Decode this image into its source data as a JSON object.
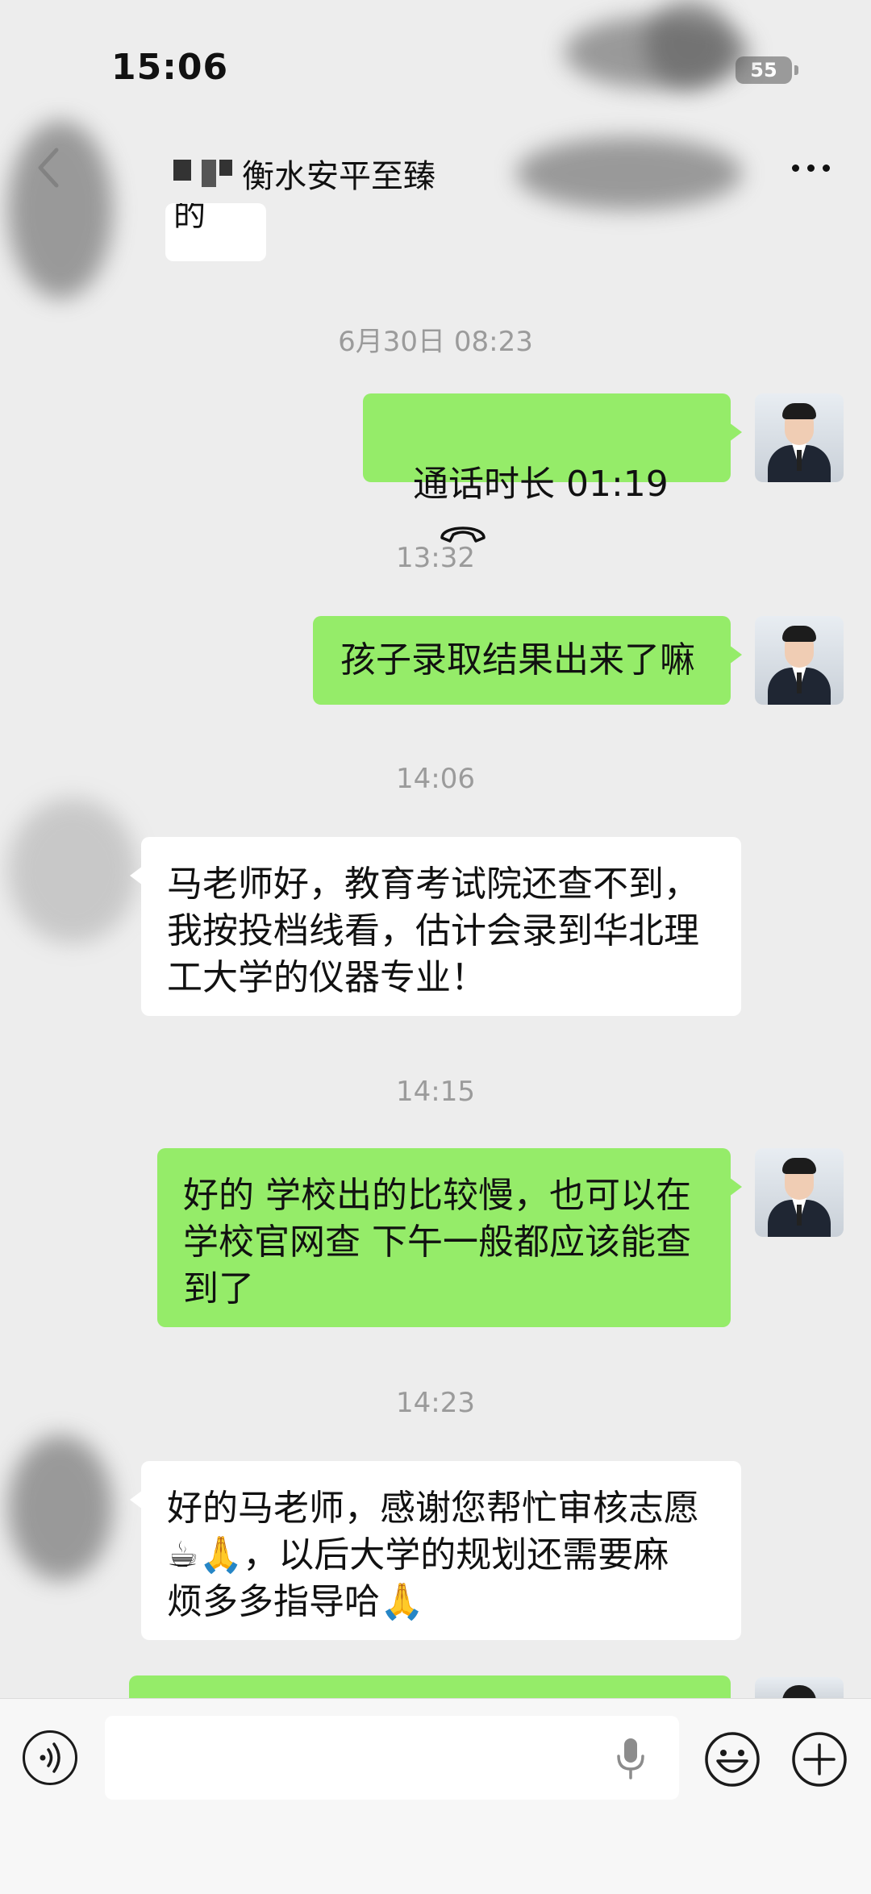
{
  "status_bar": {
    "time": "15:06",
    "battery": "55"
  },
  "nav": {
    "title": "衡水安平至臻"
  },
  "partial_message": "的",
  "messages": [
    {
      "time": "6月30日 08:23",
      "call_label": "通话时长 01:19"
    },
    {
      "time": "13:32",
      "text": "孩子录取结果出来了嘛"
    },
    {
      "time": "14:06",
      "text": "马老师好，教育考试院还查不到，\n我按投档线看，估计会录到华北理\n工大学的仪器专业！"
    },
    {
      "time": "14:15",
      "text": "好的 学校出的比较慢，也可以在\n学校官网查 下午一般都应该能查\n到了"
    },
    {
      "time": "14:23",
      "text": "好的马老师，感谢您帮忙审核志愿\n☕🙏，以后大学的规划还需要麻\n烦多多指导哈🙏"
    }
  ],
  "input": {
    "value": "",
    "placeholder": ""
  },
  "icons": {
    "back": "chevron-left-icon",
    "more": "more-icon",
    "call": "phone-hangup-icon",
    "voice": "voice-mode-icon",
    "mic": "microphone-icon",
    "emoji": "emoji-icon",
    "plus": "plus-icon"
  },
  "colors": {
    "sent_bubble": "#95ec69",
    "received_bubble": "#ffffff",
    "background": "#ededed",
    "timestamp": "#9b9b9b"
  }
}
